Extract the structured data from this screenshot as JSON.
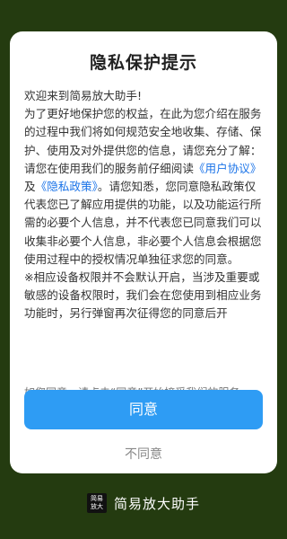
{
  "dialog": {
    "title": "隐私保护提示",
    "greeting": "欢迎来到简易放大助手!",
    "para1_a": "为了更好地保护您的权益，在此为您介绍在服务的过程中我们将如何规范安全地收集、存储、保护、使用及对外提供您的信息，请您充分了解：请您在使用我们的服务前仔细阅读",
    "user_agreement_link": "《用户协议》",
    "para1_and": "及",
    "privacy_policy_link": "《隐私政策》",
    "para1_b": "。请您知悉，您同意隐私政策仅代表您已了解应用提供的功能，以及功能运行所需的必要个人信息，并不代表您已同意我们可以收集非必要个人信息，非必要个人信息会根据您使用过程中的授权情况单独征求您的同意。",
    "para2": "※相应设备权限并不会默认开启，当涉及重要或敏感的设备权限时，我们会在您使用到相应业务功能时，另行弹窗再次征得您的同意后开",
    "consent_hint": "如您同意，请点击“同意”开始接受我们的服务。",
    "agree_label": "同意",
    "disagree_label": "不同意"
  },
  "brand": {
    "logo_text": "简易放大",
    "name": "简易放大助手"
  },
  "colors": {
    "background": "#243b10",
    "accent": "#2e9cf4",
    "link": "#1a73e8"
  }
}
